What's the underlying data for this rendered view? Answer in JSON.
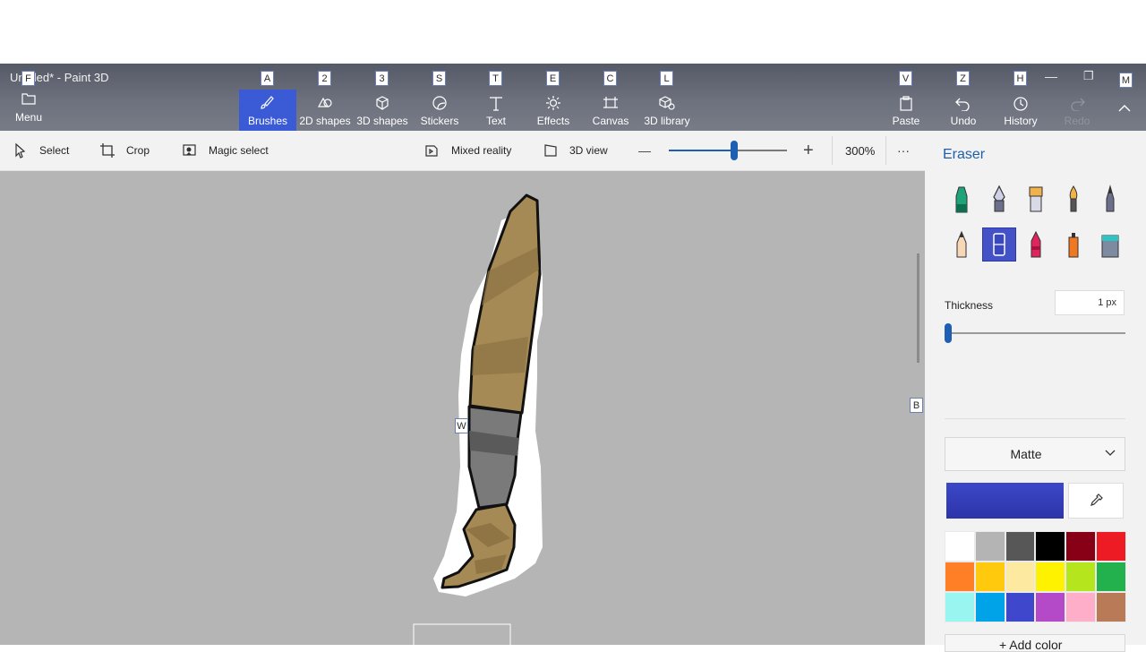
{
  "window": {
    "title": "Untitled* - Paint 3D"
  },
  "menu": {
    "label": "Menu"
  },
  "ribbon": {
    "tools": [
      {
        "label": "Brushes",
        "icon": "brush-icon",
        "key": "A"
      },
      {
        "label": "2D shapes",
        "icon": "2d-shapes-icon",
        "key": "2"
      },
      {
        "label": "3D shapes",
        "icon": "3d-shapes-icon",
        "key": "3"
      },
      {
        "label": "Stickers",
        "icon": "sticker-icon",
        "key": "S"
      },
      {
        "label": "Text",
        "icon": "text-icon",
        "key": "T"
      },
      {
        "label": "Effects",
        "icon": "effects-icon",
        "key": "E"
      },
      {
        "label": "Canvas",
        "icon": "canvas-icon",
        "key": "C"
      },
      {
        "label": "3D library",
        "icon": "3d-library-icon",
        "key": "L"
      }
    ],
    "right_tools": [
      {
        "label": "Paste",
        "icon": "paste-icon",
        "key": "V"
      },
      {
        "label": "Undo",
        "icon": "undo-icon",
        "key": "Z"
      },
      {
        "label": "History",
        "icon": "history-icon",
        "key": "H"
      },
      {
        "label": "Redo",
        "icon": "redo-icon"
      }
    ],
    "key_tips": {
      "menu": "F",
      "collapse": "M",
      "canvas": "W",
      "panel": "B"
    }
  },
  "toolbar": {
    "select": "Select",
    "crop": "Crop",
    "magic_select": "Magic select",
    "mixed_reality": "Mixed reality",
    "view3d": "3D view",
    "zoom_label": "300%",
    "zoom_minus": "—",
    "zoom_plus": "+",
    "more": "···"
  },
  "zoom": {
    "level_fraction": 0.55
  },
  "panel": {
    "title": "Eraser",
    "brushes": [
      "marker-icon",
      "calligraphy-pen-icon",
      "oil-brush-icon",
      "watercolor-icon",
      "pixel-pen-icon",
      "pencil-icon",
      "eraser-icon",
      "crayon-icon",
      "spray-can-icon",
      "fill-bucket-icon"
    ],
    "selected_brush": "eraser-icon",
    "thickness_label": "Thickness",
    "thickness_value": "1 px",
    "finish": "Matte",
    "current_color": "#3c48c8",
    "palette": [
      "#ffffff",
      "#b4b4b4",
      "#575757",
      "#000000",
      "#880015",
      "#ed1c24",
      "#ff7f27",
      "#ffc90e",
      "#fde9a0",
      "#fff200",
      "#b5e61d",
      "#22b14c",
      "#99f5f0",
      "#00a2e8",
      "#3f48cc",
      "#b44ac8",
      "#ffaec9",
      "#b97a57"
    ],
    "add_color": "+ Add color"
  },
  "colors": {
    "accent": "#3b5bd6",
    "panel_title": "#1f5fa8"
  }
}
